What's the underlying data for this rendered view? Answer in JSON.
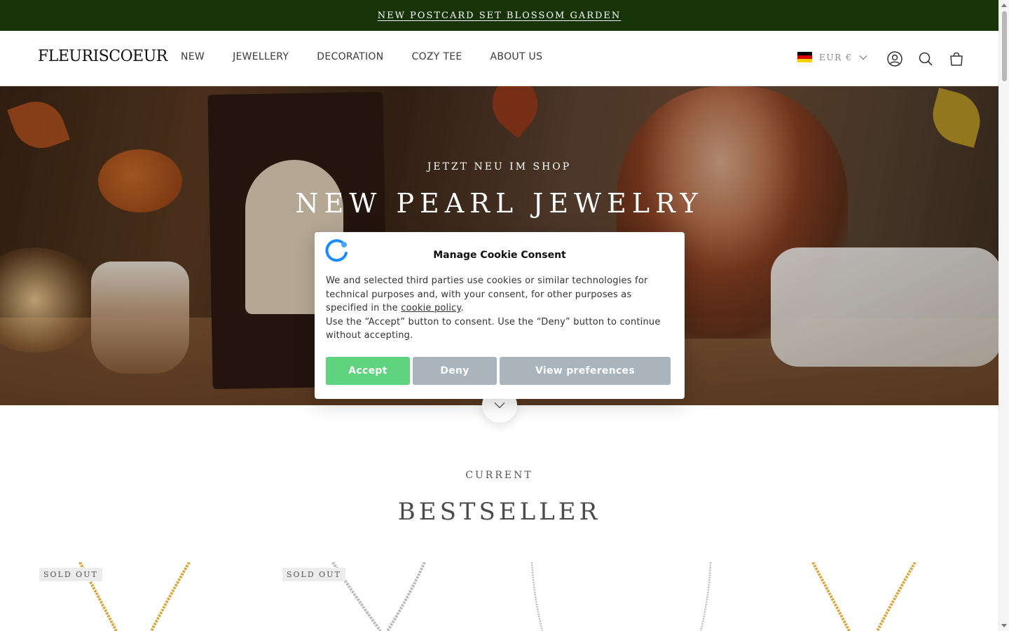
{
  "announcement": {
    "text": "NEW POSTCARD SET BLOSSOM GARDEN"
  },
  "header": {
    "logo": "FLEURISCOEUR",
    "nav": [
      "NEW",
      "JEWELLERY",
      "DECORATION",
      "COZY TEE",
      "ABOUT US"
    ],
    "currency": "EUR €",
    "icons": [
      "account-icon",
      "search-icon",
      "cart-icon"
    ]
  },
  "hero": {
    "kicker": "JETZT NEU IM SHOP",
    "title": "NEW PEARL JEWELRY"
  },
  "cookie": {
    "title": "Manage Cookie Consent",
    "body_1": "We and selected third parties use cookies or similar technologies for technical purposes and, with your consent, for other purposes as specified in the",
    "policy_link": "cookie policy",
    "body_2": ".",
    "body_3": "Use the “Accept” button to consent. Use the “Deny” button to continue without accepting.",
    "accept": "Accept",
    "deny": "Deny",
    "preferences": "View preferences",
    "colors": {
      "accept": "#5fd37e",
      "secondary": "#aab4bd"
    }
  },
  "bestseller": {
    "kicker": "CURRENT",
    "title": "BESTSELLER",
    "products": [
      {
        "badge": "SOLD OUT",
        "chain": "gold"
      },
      {
        "badge": "SOLD OUT",
        "chain": "silver"
      },
      {
        "badge": "",
        "chain": "silver"
      },
      {
        "badge": "",
        "chain": "silver"
      },
      {
        "badge": "",
        "chain": "gold"
      }
    ]
  },
  "colors": {
    "announcement_bg": "#173409"
  }
}
